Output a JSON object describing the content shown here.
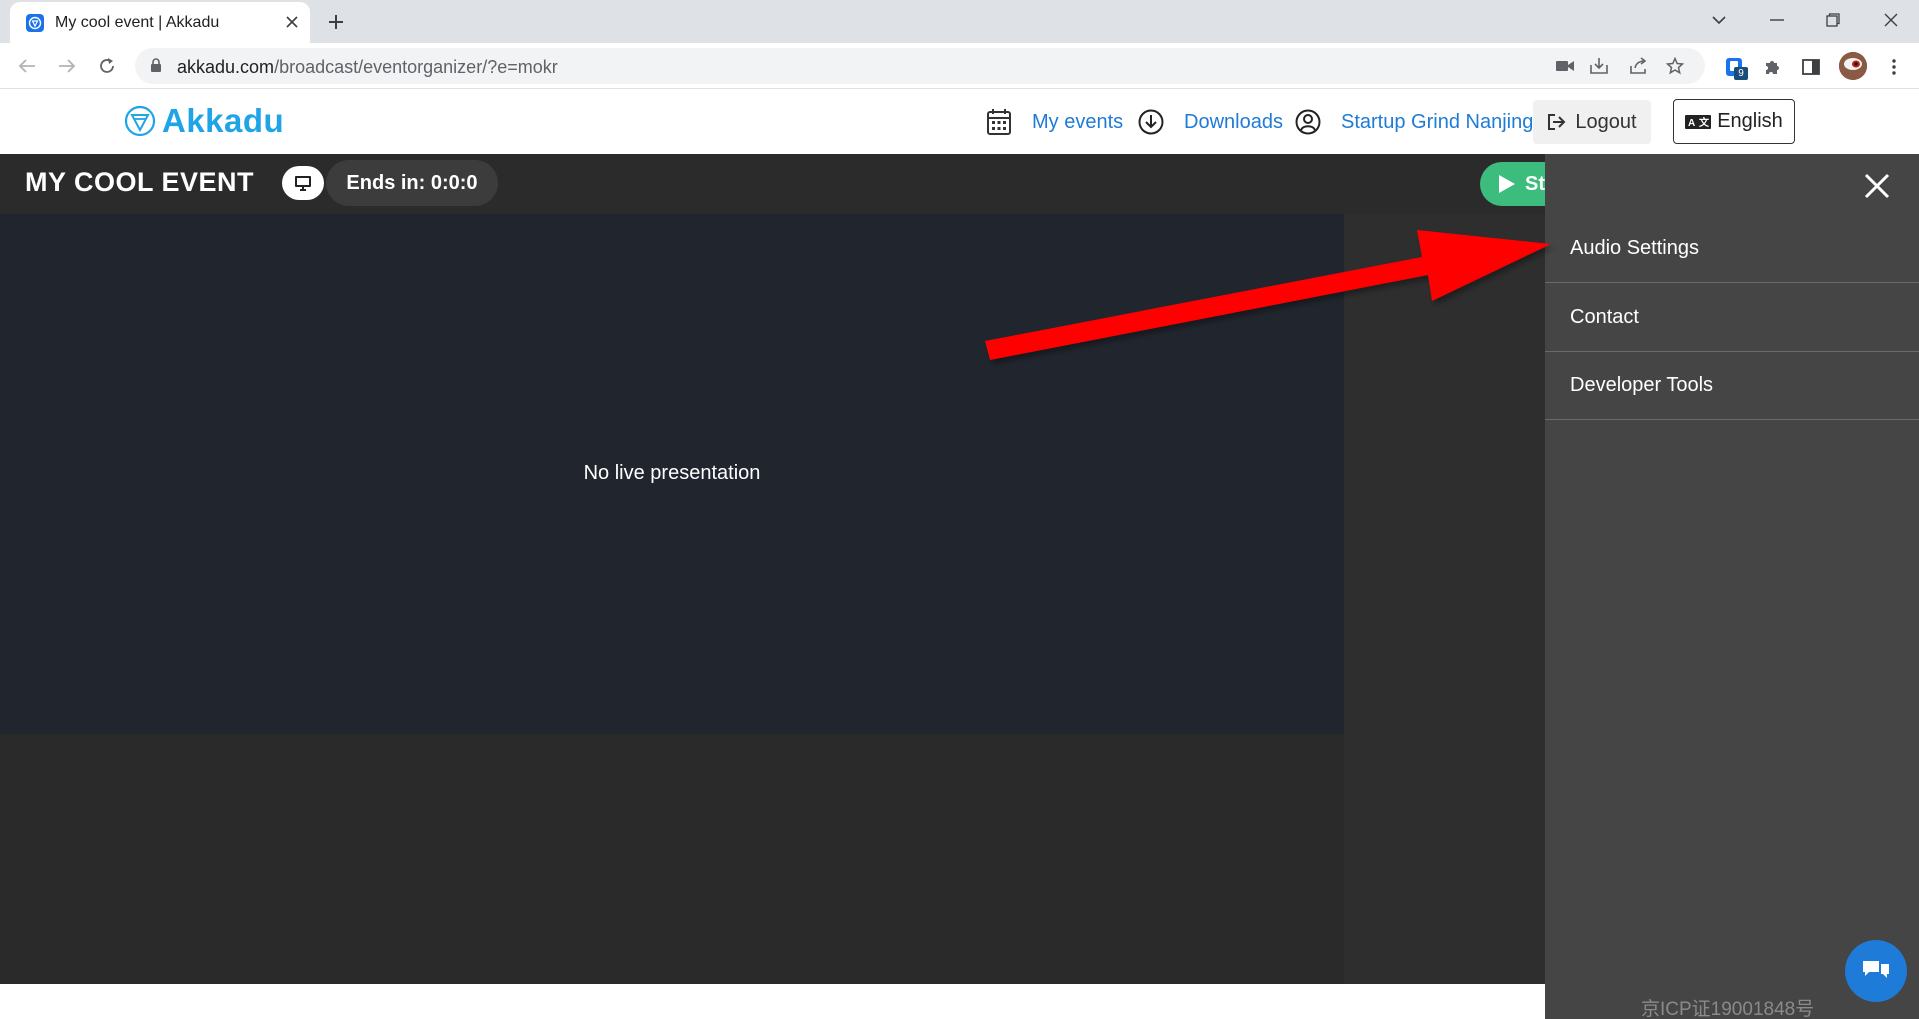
{
  "browser": {
    "tab_title": "My cool event | Akkadu",
    "url_host": "akkadu.com",
    "url_path": "/broadcast/eventorganizer/?e=mokr",
    "extension_badge": "9"
  },
  "site": {
    "logo_text": "Akkadu",
    "nav": {
      "my_events": "My events",
      "downloads": "Downloads",
      "organization": "Startup Grind Nanjing",
      "logout": "Logout",
      "language": "English"
    }
  },
  "event": {
    "title": "MY COOL EVENT",
    "ends_in": "Ends in: 0:0:0",
    "start_label": "St"
  },
  "stage": {
    "message": "No live presentation"
  },
  "drawer": {
    "items": [
      {
        "label": "Audio Settings"
      },
      {
        "label": "Contact"
      },
      {
        "label": "Developer Tools"
      }
    ],
    "icp": "京ICP证19001848号"
  },
  "colors": {
    "brand": "#20a4e8",
    "link": "#1e7bd8",
    "start_green": "#3dbd7d",
    "drawer_bg": "#454545",
    "stage_bg": "#21252d",
    "annotation_arrow": "#ff0000"
  },
  "icons": {
    "tab_favicon": "akkadu-favicon-icon",
    "calendar": "calendar-icon",
    "download": "download-circle-icon",
    "user": "user-circle-icon",
    "logout": "sign-out-icon",
    "language": "language-icon",
    "screen": "monitor-icon",
    "play": "play-icon",
    "close": "close-icon",
    "chat": "chat-icon"
  }
}
